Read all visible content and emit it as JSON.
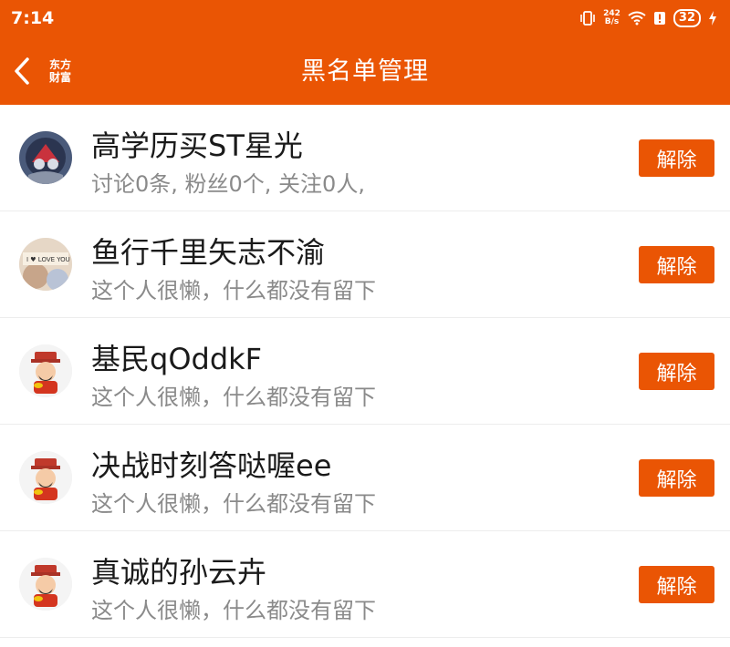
{
  "status": {
    "time": "7:14",
    "net_speed_value": "242",
    "net_speed_unit": "B/s",
    "battery": "32"
  },
  "header": {
    "title": "黑名单管理",
    "logo_line1": "东方",
    "logo_line2": "财富"
  },
  "colors": {
    "accent": "#EA5504"
  },
  "users": [
    {
      "name": "高学历买ST星光",
      "desc": "讨论0条, 粉丝0个, 关注0人,",
      "avatar": "spiderman-avatar",
      "action": "解除"
    },
    {
      "name": "鱼行千里矢志不渝",
      "desc": "这个人很懒，什么都没有留下",
      "avatar": "i-love-you-avatar",
      "action": "解除"
    },
    {
      "name": "基民qOddkF",
      "desc": "这个人很懒，什么都没有留下",
      "avatar": "fortune-god-avatar",
      "action": "解除"
    },
    {
      "name": "决战时刻答哒喔ee",
      "desc": "这个人很懒，什么都没有留下",
      "avatar": "fortune-god-avatar",
      "action": "解除"
    },
    {
      "name": "真诚的孙云卉",
      "desc": "这个人很懒，什么都没有留下",
      "avatar": "fortune-god-avatar",
      "action": "解除"
    }
  ]
}
